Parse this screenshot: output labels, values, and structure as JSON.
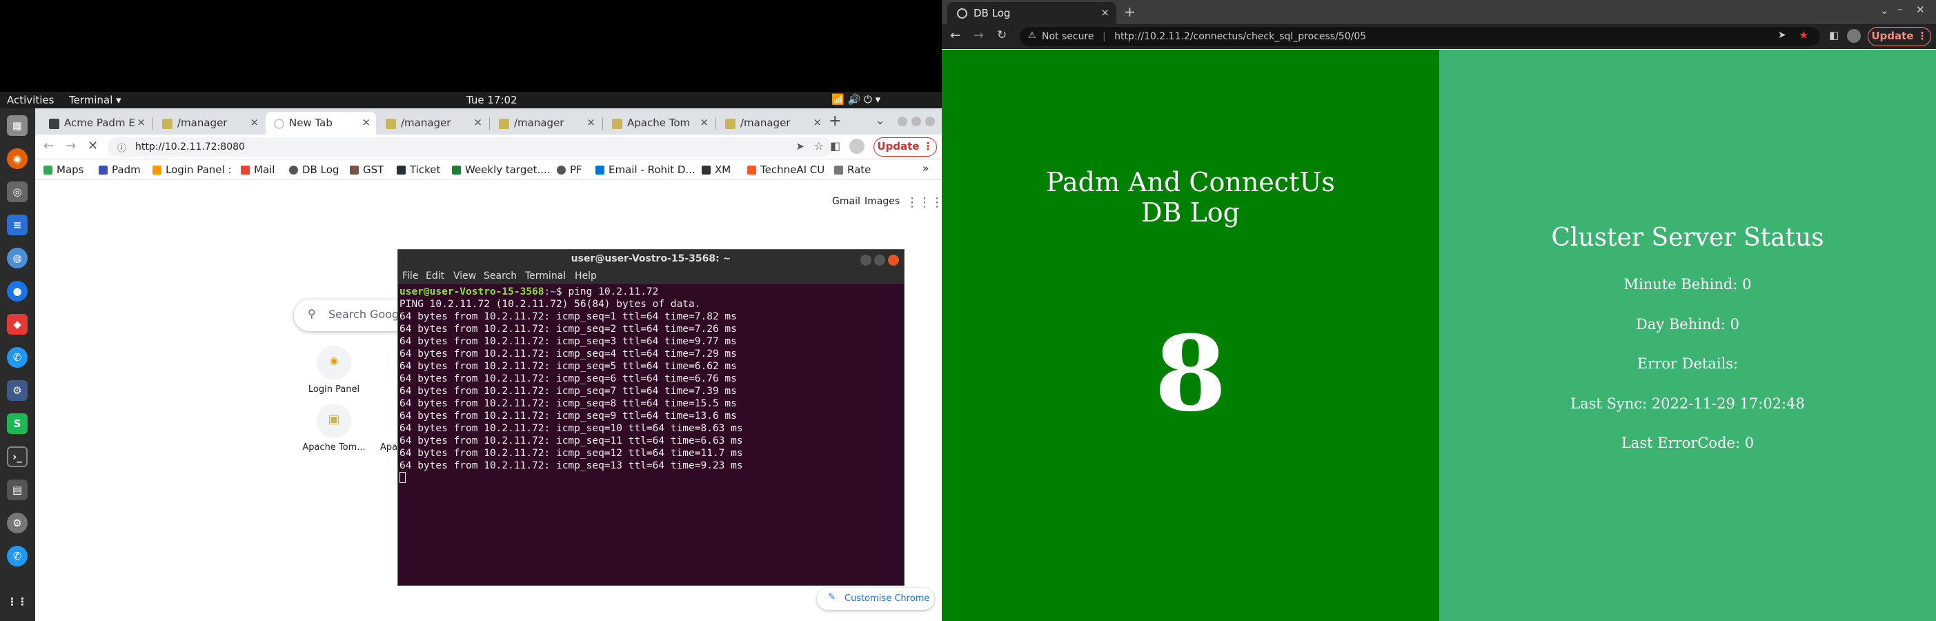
{
  "left": {
    "topbar": {
      "activities": "Activities",
      "app": "Terminal",
      "clock": "Tue 17:02"
    },
    "browser": {
      "tabs": [
        {
          "label": "Acme Padm E"
        },
        {
          "label": "/manager"
        },
        {
          "label": "New Tab"
        },
        {
          "label": "/manager"
        },
        {
          "label": "/manager"
        },
        {
          "label": "Apache Tom"
        },
        {
          "label": "/manager"
        }
      ],
      "url": "http://10.2.11.72:8080",
      "update_label": "Update",
      "bookmarks": [
        "Maps",
        "Padm",
        "Login Panel :",
        "Mail",
        "DB Log",
        "GST",
        "Ticket",
        "Weekly target....",
        "PF",
        "Email - Rohit D...",
        "XM",
        "TechneAI CU",
        "Rate"
      ],
      "ntp": {
        "gmail": "Gmail",
        "images": "Images",
        "search_placeholder": "Search Google",
        "shortcuts": [
          {
            "label": "Login Panel"
          },
          {
            "label": "Apache Tom..."
          },
          {
            "label": "Apac"
          }
        ],
        "customise": "Customise Chrome"
      }
    },
    "terminal": {
      "title": "user@user-Vostro-15-3568: ~",
      "menu": [
        "File",
        "Edit",
        "View",
        "Search",
        "Terminal",
        "Help"
      ],
      "prompt_user": "user@user-Vostro-15-3568",
      "prompt_path": ":~",
      "command": "$ ping 10.2.11.72",
      "lines": [
        "PING 10.2.11.72 (10.2.11.72) 56(84) bytes of data.",
        "64 bytes from 10.2.11.72: icmp_seq=1 ttl=64 time=7.82 ms",
        "64 bytes from 10.2.11.72: icmp_seq=2 ttl=64 time=7.26 ms",
        "64 bytes from 10.2.11.72: icmp_seq=3 ttl=64 time=9.77 ms",
        "64 bytes from 10.2.11.72: icmp_seq=4 ttl=64 time=7.29 ms",
        "64 bytes from 10.2.11.72: icmp_seq=5 ttl=64 time=6.62 ms",
        "64 bytes from 10.2.11.72: icmp_seq=6 ttl=64 time=6.76 ms",
        "64 bytes from 10.2.11.72: icmp_seq=7 ttl=64 time=7.39 ms",
        "64 bytes from 10.2.11.72: icmp_seq=8 ttl=64 time=15.5 ms",
        "64 bytes from 10.2.11.72: icmp_seq=9 ttl=64 time=13.6 ms",
        "64 bytes from 10.2.11.72: icmp_seq=10 ttl=64 time=8.63 ms",
        "64 bytes from 10.2.11.72: icmp_seq=11 ttl=64 time=6.63 ms",
        "64 bytes from 10.2.11.72: icmp_seq=12 ttl=64 time=11.7 ms",
        "64 bytes from 10.2.11.72: icmp_seq=13 ttl=64 time=9.23 ms"
      ]
    }
  },
  "right": {
    "tab_title": "DB Log",
    "not_secure": "Not secure",
    "url": "http://10.2.11.2/connectus/check_sql_process/50/05",
    "update_label": "Update",
    "page": {
      "title_line1": "Padm And ConnectUs",
      "title_line2": "DB Log",
      "big_number": "8",
      "status_title": "Cluster Server Status",
      "minute_behind": "Minute Behind: 0",
      "day_behind": "Day Behind: 0",
      "error_details": "Error Details:",
      "last_sync": "Last Sync: 2022-11-29 17:02:48",
      "last_errorcode": "Last ErrorCode: 0"
    }
  },
  "colors": {
    "left_panel": "#008000",
    "right_panel": "#3cb371",
    "terminal_bg": "#300a24"
  }
}
